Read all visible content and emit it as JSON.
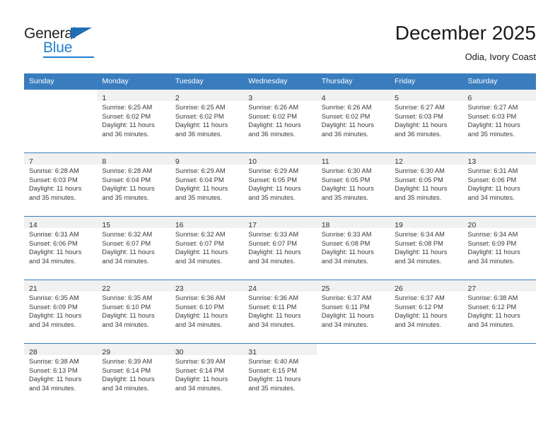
{
  "brand": {
    "name_top": "General",
    "name_bottom": "Blue",
    "accent_color": "#1f7fd0",
    "triangle_color": "#1f6fb4"
  },
  "header": {
    "title": "December 2025",
    "subtitle": "Odia, Ivory Coast"
  },
  "theme": {
    "header_row_bg": "#3a7dbf",
    "daynum_band_bg": "#f1f1f1",
    "week_separator": "#3a7dbf"
  },
  "weekday_headers": [
    "Sunday",
    "Monday",
    "Tuesday",
    "Wednesday",
    "Thursday",
    "Friday",
    "Saturday"
  ],
  "weeks": [
    [
      {
        "day": "",
        "sunrise": "",
        "sunset": "",
        "daylight_1": "",
        "daylight_2": ""
      },
      {
        "day": "1",
        "sunrise": "Sunrise: 6:25 AM",
        "sunset": "Sunset: 6:02 PM",
        "daylight_1": "Daylight: 11 hours",
        "daylight_2": "and 36 minutes."
      },
      {
        "day": "2",
        "sunrise": "Sunrise: 6:25 AM",
        "sunset": "Sunset: 6:02 PM",
        "daylight_1": "Daylight: 11 hours",
        "daylight_2": "and 36 minutes."
      },
      {
        "day": "3",
        "sunrise": "Sunrise: 6:26 AM",
        "sunset": "Sunset: 6:02 PM",
        "daylight_1": "Daylight: 11 hours",
        "daylight_2": "and 36 minutes."
      },
      {
        "day": "4",
        "sunrise": "Sunrise: 6:26 AM",
        "sunset": "Sunset: 6:02 PM",
        "daylight_1": "Daylight: 11 hours",
        "daylight_2": "and 36 minutes."
      },
      {
        "day": "5",
        "sunrise": "Sunrise: 6:27 AM",
        "sunset": "Sunset: 6:03 PM",
        "daylight_1": "Daylight: 11 hours",
        "daylight_2": "and 36 minutes."
      },
      {
        "day": "6",
        "sunrise": "Sunrise: 6:27 AM",
        "sunset": "Sunset: 6:03 PM",
        "daylight_1": "Daylight: 11 hours",
        "daylight_2": "and 35 minutes."
      }
    ],
    [
      {
        "day": "7",
        "sunrise": "Sunrise: 6:28 AM",
        "sunset": "Sunset: 6:03 PM",
        "daylight_1": "Daylight: 11 hours",
        "daylight_2": "and 35 minutes."
      },
      {
        "day": "8",
        "sunrise": "Sunrise: 6:28 AM",
        "sunset": "Sunset: 6:04 PM",
        "daylight_1": "Daylight: 11 hours",
        "daylight_2": "and 35 minutes."
      },
      {
        "day": "9",
        "sunrise": "Sunrise: 6:29 AM",
        "sunset": "Sunset: 6:04 PM",
        "daylight_1": "Daylight: 11 hours",
        "daylight_2": "and 35 minutes."
      },
      {
        "day": "10",
        "sunrise": "Sunrise: 6:29 AM",
        "sunset": "Sunset: 6:05 PM",
        "daylight_1": "Daylight: 11 hours",
        "daylight_2": "and 35 minutes."
      },
      {
        "day": "11",
        "sunrise": "Sunrise: 6:30 AM",
        "sunset": "Sunset: 6:05 PM",
        "daylight_1": "Daylight: 11 hours",
        "daylight_2": "and 35 minutes."
      },
      {
        "day": "12",
        "sunrise": "Sunrise: 6:30 AM",
        "sunset": "Sunset: 6:05 PM",
        "daylight_1": "Daylight: 11 hours",
        "daylight_2": "and 35 minutes."
      },
      {
        "day": "13",
        "sunrise": "Sunrise: 6:31 AM",
        "sunset": "Sunset: 6:06 PM",
        "daylight_1": "Daylight: 11 hours",
        "daylight_2": "and 34 minutes."
      }
    ],
    [
      {
        "day": "14",
        "sunrise": "Sunrise: 6:31 AM",
        "sunset": "Sunset: 6:06 PM",
        "daylight_1": "Daylight: 11 hours",
        "daylight_2": "and 34 minutes."
      },
      {
        "day": "15",
        "sunrise": "Sunrise: 6:32 AM",
        "sunset": "Sunset: 6:07 PM",
        "daylight_1": "Daylight: 11 hours",
        "daylight_2": "and 34 minutes."
      },
      {
        "day": "16",
        "sunrise": "Sunrise: 6:32 AM",
        "sunset": "Sunset: 6:07 PM",
        "daylight_1": "Daylight: 11 hours",
        "daylight_2": "and 34 minutes."
      },
      {
        "day": "17",
        "sunrise": "Sunrise: 6:33 AM",
        "sunset": "Sunset: 6:07 PM",
        "daylight_1": "Daylight: 11 hours",
        "daylight_2": "and 34 minutes."
      },
      {
        "day": "18",
        "sunrise": "Sunrise: 6:33 AM",
        "sunset": "Sunset: 6:08 PM",
        "daylight_1": "Daylight: 11 hours",
        "daylight_2": "and 34 minutes."
      },
      {
        "day": "19",
        "sunrise": "Sunrise: 6:34 AM",
        "sunset": "Sunset: 6:08 PM",
        "daylight_1": "Daylight: 11 hours",
        "daylight_2": "and 34 minutes."
      },
      {
        "day": "20",
        "sunrise": "Sunrise: 6:34 AM",
        "sunset": "Sunset: 6:09 PM",
        "daylight_1": "Daylight: 11 hours",
        "daylight_2": "and 34 minutes."
      }
    ],
    [
      {
        "day": "21",
        "sunrise": "Sunrise: 6:35 AM",
        "sunset": "Sunset: 6:09 PM",
        "daylight_1": "Daylight: 11 hours",
        "daylight_2": "and 34 minutes."
      },
      {
        "day": "22",
        "sunrise": "Sunrise: 6:35 AM",
        "sunset": "Sunset: 6:10 PM",
        "daylight_1": "Daylight: 11 hours",
        "daylight_2": "and 34 minutes."
      },
      {
        "day": "23",
        "sunrise": "Sunrise: 6:36 AM",
        "sunset": "Sunset: 6:10 PM",
        "daylight_1": "Daylight: 11 hours",
        "daylight_2": "and 34 minutes."
      },
      {
        "day": "24",
        "sunrise": "Sunrise: 6:36 AM",
        "sunset": "Sunset: 6:11 PM",
        "daylight_1": "Daylight: 11 hours",
        "daylight_2": "and 34 minutes."
      },
      {
        "day": "25",
        "sunrise": "Sunrise: 6:37 AM",
        "sunset": "Sunset: 6:11 PM",
        "daylight_1": "Daylight: 11 hours",
        "daylight_2": "and 34 minutes."
      },
      {
        "day": "26",
        "sunrise": "Sunrise: 6:37 AM",
        "sunset": "Sunset: 6:12 PM",
        "daylight_1": "Daylight: 11 hours",
        "daylight_2": "and 34 minutes."
      },
      {
        "day": "27",
        "sunrise": "Sunrise: 6:38 AM",
        "sunset": "Sunset: 6:12 PM",
        "daylight_1": "Daylight: 11 hours",
        "daylight_2": "and 34 minutes."
      }
    ],
    [
      {
        "day": "28",
        "sunrise": "Sunrise: 6:38 AM",
        "sunset": "Sunset: 6:13 PM",
        "daylight_1": "Daylight: 11 hours",
        "daylight_2": "and 34 minutes."
      },
      {
        "day": "29",
        "sunrise": "Sunrise: 6:39 AM",
        "sunset": "Sunset: 6:14 PM",
        "daylight_1": "Daylight: 11 hours",
        "daylight_2": "and 34 minutes."
      },
      {
        "day": "30",
        "sunrise": "Sunrise: 6:39 AM",
        "sunset": "Sunset: 6:14 PM",
        "daylight_1": "Daylight: 11 hours",
        "daylight_2": "and 34 minutes."
      },
      {
        "day": "31",
        "sunrise": "Sunrise: 6:40 AM",
        "sunset": "Sunset: 6:15 PM",
        "daylight_1": "Daylight: 11 hours",
        "daylight_2": "and 35 minutes."
      },
      {
        "day": "",
        "sunrise": "",
        "sunset": "",
        "daylight_1": "",
        "daylight_2": ""
      },
      {
        "day": "",
        "sunrise": "",
        "sunset": "",
        "daylight_1": "",
        "daylight_2": ""
      },
      {
        "day": "",
        "sunrise": "",
        "sunset": "",
        "daylight_1": "",
        "daylight_2": ""
      }
    ]
  ]
}
